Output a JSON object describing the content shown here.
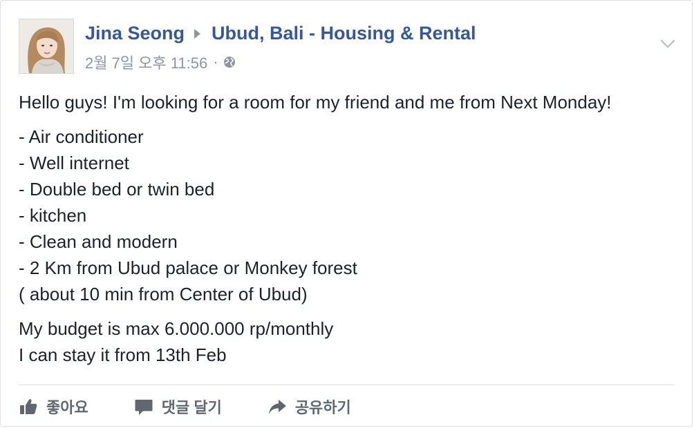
{
  "post": {
    "author": "Jina Seong",
    "group": "Ubud, Bali - Housing & Rental",
    "timestamp": "2월 7일 오후 11:56",
    "separator": "·",
    "privacy_icon": "globe-icon",
    "menu_icon": "chevron-down-icon",
    "body": {
      "intro": "Hello guys! I'm looking for a room for my friend and me from Next Monday!",
      "list": [
        "- Air conditioner",
        "- Well internet",
        "- Double bed or twin bed",
        "- kitchen",
        "- Clean and modern",
        "- 2 Km from Ubud palace or Monkey forest",
        "( about 10 min from Center of Ubud)"
      ],
      "closing": [
        "My budget is max 6.000.000 rp/monthly",
        "I can stay it from 13th Feb"
      ]
    }
  },
  "actions": {
    "like": {
      "label": "좋아요",
      "icon": "thumbs-up-icon"
    },
    "comment": {
      "label": "댓글 달기",
      "icon": "comment-icon"
    },
    "share": {
      "label": "공유하기",
      "icon": "share-arrow-icon"
    }
  },
  "colors": {
    "link": "#365899",
    "meta": "#90949c",
    "text": "#1d2129",
    "action": "#606770",
    "divider": "#dddfe2"
  }
}
